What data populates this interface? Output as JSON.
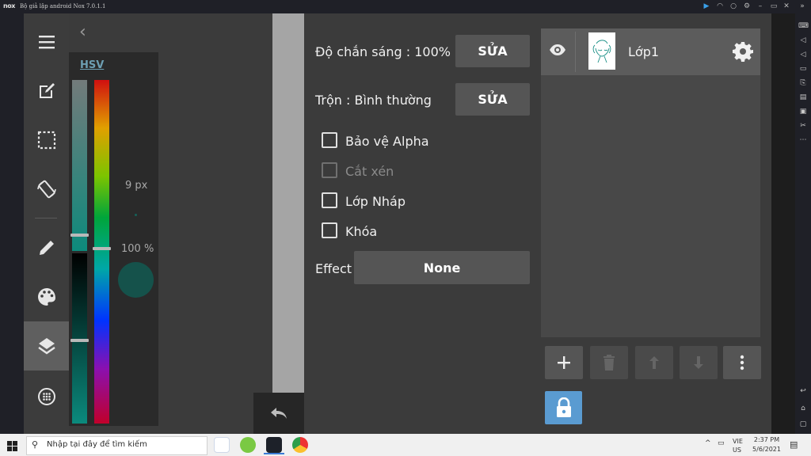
{
  "window": {
    "logo": "nox",
    "title": "Bộ giả lập android Nox 7.0.1.1"
  },
  "color_panel": {
    "mode_label": "HSV",
    "brush_size": "9 px",
    "opacity": "100 %"
  },
  "properties": {
    "opacity_label": "Độ chắn sáng : 100%",
    "opacity_edit": "SỬA",
    "blend_label": "Trộn : Bình thường",
    "blend_edit": "SỬA",
    "checkboxes": [
      {
        "label": "Bảo vệ Alpha",
        "checked": false,
        "enabled": true
      },
      {
        "label": "Cắt xén",
        "checked": false,
        "enabled": false
      },
      {
        "label": "Lớp Nháp",
        "checked": false,
        "enabled": true
      },
      {
        "label": "Khóa",
        "checked": false,
        "enabled": true
      }
    ],
    "effect_label": "Effect",
    "effect_value": "None"
  },
  "layers": {
    "items": [
      {
        "name": "Lớp1",
        "visible": true
      }
    ]
  },
  "toolbar": {
    "tools": [
      "edit-icon",
      "selection-icon",
      "rotate-icon",
      "pen-icon",
      "palette-icon",
      "layers-icon",
      "grid-icon"
    ],
    "active_tool": "layers-icon"
  },
  "taskbar": {
    "search_placeholder": "Nhập tại đây để tìm kiếm",
    "lang_top": "VIE",
    "lang_bottom": "US",
    "time": "2:37 PM",
    "date": "5/6/2021"
  },
  "colors": {
    "accent": "#5a9bd1",
    "current_color": "#15524b",
    "hsv_link": "#6d9fb3"
  }
}
